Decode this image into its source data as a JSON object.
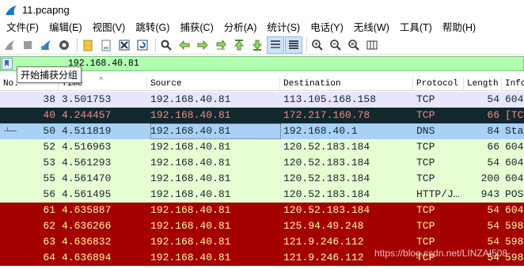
{
  "window": {
    "title": "11.pcapng"
  },
  "menu": [
    "文件(F)",
    "编辑(E)",
    "视图(V)",
    "跳转(G)",
    "捕获(C)",
    "分析(A)",
    "统计(S)",
    "电话(Y)",
    "无线(W)",
    "工具(T)",
    "帮助(H)"
  ],
  "toolbar": {
    "icons": [
      "shark-fin-icon",
      "stop-icon",
      "restart-icon",
      "options-icon",
      "open-file-icon",
      "save-file-icon",
      "close-file-icon",
      "reload-icon",
      "find-icon",
      "go-back-icon",
      "go-forward-icon",
      "go-to-packet-icon",
      "first-packet-icon",
      "last-packet-icon",
      "autoscroll-icon",
      "colorize-icon",
      "zoom-in-icon",
      "zoom-out-icon",
      "normal-size-icon",
      "resize-columns-icon"
    ]
  },
  "filter": {
    "value": "192.168.40.81",
    "background": "#afffaf"
  },
  "tooltip": {
    "text": "开始捕获分组"
  },
  "columns": [
    "No.",
    "Time",
    "Source",
    "Destination",
    "Protocol",
    "Length",
    "Info"
  ],
  "packets": [
    {
      "no": "38",
      "time": "3.501753",
      "src": "192.168.40.81",
      "dst": "113.105.168.158",
      "proto": "TCP",
      "len": "54",
      "info": "604",
      "bg": "#e7e6ff",
      "fg": "#12272e"
    },
    {
      "no": "40",
      "time": "4.244457",
      "src": "192.168.40.81",
      "dst": "172.217.160.78",
      "proto": "TCP",
      "len": "66",
      "info": "[TC",
      "bg": "#12272e",
      "fg": "#f78787"
    },
    {
      "no": "50",
      "time": "4.511819",
      "src": "192.168.40.81",
      "dst": "192.168.40.1",
      "proto": "DNS",
      "len": "84",
      "info": "Sta",
      "bg": "#a9d1f7",
      "fg": "#12272e"
    },
    {
      "no": "52",
      "time": "4.516963",
      "src": "192.168.40.81",
      "dst": "120.52.183.184",
      "proto": "TCP",
      "len": "66",
      "info": "604",
      "bg": "#e7fdd2",
      "fg": "#12272e"
    },
    {
      "no": "53",
      "time": "4.561293",
      "src": "192.168.40.81",
      "dst": "120.52.183.184",
      "proto": "TCP",
      "len": "54",
      "info": "604",
      "bg": "#e7fdd2",
      "fg": "#12272e"
    },
    {
      "no": "55",
      "time": "4.561470",
      "src": "192.168.40.81",
      "dst": "120.52.183.184",
      "proto": "TCP",
      "len": "200",
      "info": "604",
      "bg": "#e7fdd2",
      "fg": "#12272e"
    },
    {
      "no": "56",
      "time": "4.561495",
      "src": "192.168.40.81",
      "dst": "120.52.183.184",
      "proto": "HTTP/J…",
      "len": "943",
      "info": "POS",
      "bg": "#e7fdd2",
      "fg": "#12272e"
    },
    {
      "no": "61",
      "time": "4.635887",
      "src": "192.168.40.81",
      "dst": "120.52.183.184",
      "proto": "TCP",
      "len": "54",
      "info": "604",
      "bg": "#a40000",
      "fg": "#fffc9c"
    },
    {
      "no": "62",
      "time": "4.636266",
      "src": "192.168.40.81",
      "dst": "125.94.49.248",
      "proto": "TCP",
      "len": "54",
      "info": "598",
      "bg": "#a40000",
      "fg": "#fffc9c"
    },
    {
      "no": "63",
      "time": "4.636832",
      "src": "192.168.40.81",
      "dst": "121.9.246.112",
      "proto": "TCP",
      "len": "54",
      "info": "598",
      "bg": "#a40000",
      "fg": "#fffc9c"
    },
    {
      "no": "64",
      "time": "4.636894",
      "src": "192.168.40.81",
      "dst": "121.9.246.112",
      "proto": "TCP",
      "len": "54",
      "info": "598",
      "bg": "#a40000",
      "fg": "#fffc9c"
    }
  ],
  "selected_packet": "50",
  "watermark": "https://blog.csdn.net/LINZAI508"
}
